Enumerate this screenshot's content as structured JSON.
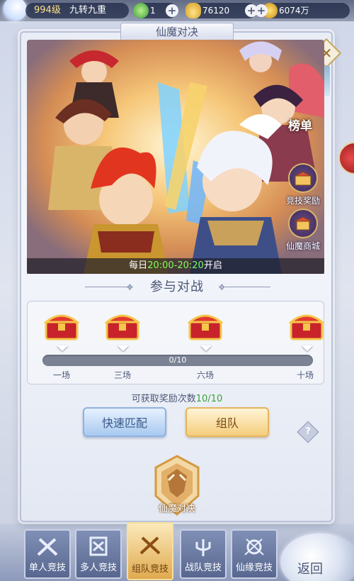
{
  "topbar": {
    "level": "994级",
    "realm": "九转九重",
    "stamina": "1",
    "ingots": "76120",
    "coins": "6074万",
    "plus": "+"
  },
  "panel": {
    "title": "仙魔对决",
    "close": "✕",
    "schedule": {
      "prefix": "每日",
      "time": "20:00-20:20",
      "suffix": "开启"
    },
    "side": {
      "rank": "榜单",
      "rewards": "竞技奖励",
      "shop": "仙魔商城"
    },
    "section_title": "参与对战",
    "progress": {
      "text": "0/10",
      "current": 0,
      "max": 10
    },
    "milestones": [
      "一场",
      "三场",
      "六场",
      "十场"
    ],
    "claims": {
      "prefix": "可获取奖励次数",
      "value": "10/10"
    },
    "buttons": {
      "quick_match": "快速匹配",
      "team": "组队"
    },
    "help": "?",
    "emblem_label": "仙魔对决"
  },
  "tabs": [
    {
      "label": "单人竞技",
      "active": false
    },
    {
      "label": "多人竞技",
      "active": false
    },
    {
      "label": "组队竞技",
      "active": true
    },
    {
      "label": "战队竞技",
      "active": false
    },
    {
      "label": "仙缘竞技",
      "active": false
    }
  ],
  "back": "返回",
  "colors": {
    "highlight_green": "#7dff5a",
    "claims_green": "#3aa33a",
    "gold": "#e0a94e"
  }
}
